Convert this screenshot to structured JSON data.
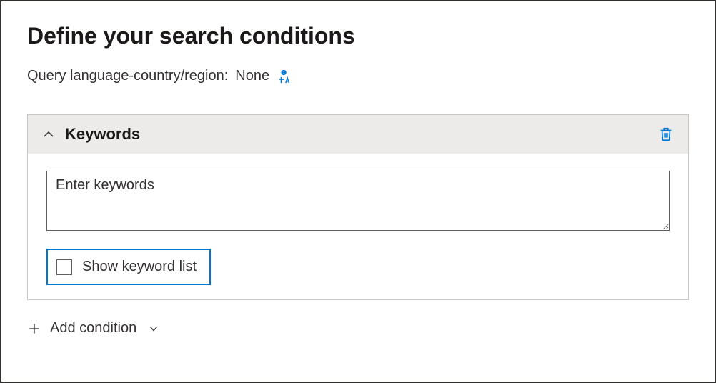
{
  "page": {
    "title": "Define your search conditions",
    "query_language_label": "Query language-country/region:",
    "query_language_value": "None"
  },
  "keywords_panel": {
    "header_label": "Keywords",
    "textarea_placeholder": "Enter keywords",
    "textarea_value": "",
    "show_keyword_list_label": "Show keyword list",
    "show_keyword_list_checked": false
  },
  "actions": {
    "add_condition_label": "Add condition"
  },
  "icons": {
    "translate": "translate-icon",
    "chevron_up": "chevron-up-icon",
    "trash": "trash-icon",
    "plus": "plus-icon",
    "chevron_down": "chevron-down-icon"
  },
  "colors": {
    "accent": "#0078d4",
    "header_bg": "#edebe9",
    "border": "#c8c6c4",
    "text": "#323130"
  }
}
